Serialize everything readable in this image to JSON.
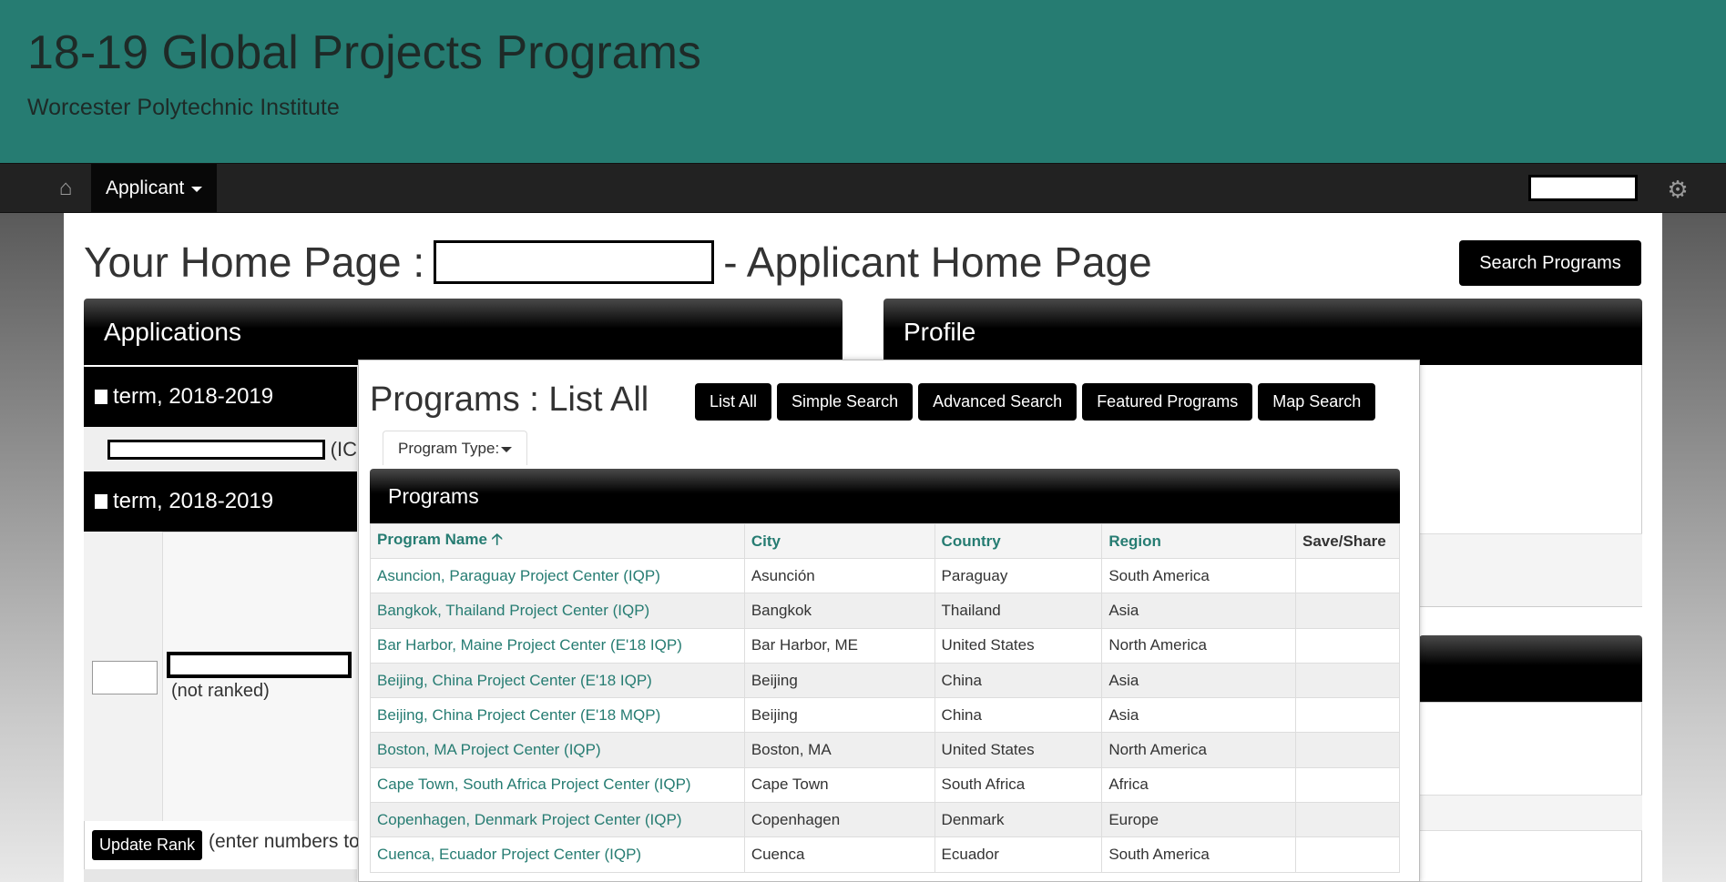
{
  "header": {
    "title": "18-19 Global Projects Programs",
    "subtitle": "Worcester Polytechnic Institute"
  },
  "navbar": {
    "home_icon": "home-icon",
    "applicant_label": "Applicant",
    "settings_icon": "gear-icon"
  },
  "page": {
    "heading_prefix": "Your Home Page :",
    "heading_suffix": "- Applicant Home Page",
    "search_programs_label": "Search Programs"
  },
  "applications": {
    "title": "Applications",
    "terms": [
      {
        "label": "term, 2018-2019"
      },
      {
        "label": "term, 2018-2019"
      }
    ],
    "first_entry_suffix": "(IC",
    "not_ranked": "(not ranked)",
    "update_rank_label": "Update Rank",
    "rank_hint": "(enter numbers to"
  },
  "profile": {
    "title": "Profile"
  },
  "modal": {
    "title": "Programs : List All",
    "buttons": [
      "List All",
      "Simple Search",
      "Advanced Search",
      "Featured Programs",
      "Map Search"
    ],
    "program_type_label": "Program Type:",
    "panel_title": "Programs",
    "columns": [
      "Program Name",
      "City",
      "Country",
      "Region",
      "Save/Share"
    ],
    "sort_indicator": "arrow-up-icon",
    "rows": [
      {
        "name": "Asuncion, Paraguay Project Center (IQP)",
        "city": "Asunción",
        "country": "Paraguay",
        "region": "South America"
      },
      {
        "name": "Bangkok, Thailand Project Center (IQP)",
        "city": "Bangkok",
        "country": "Thailand",
        "region": "Asia"
      },
      {
        "name": "Bar Harbor, Maine Project Center (E'18 IQP)",
        "city": "Bar Harbor, ME",
        "country": "United States",
        "region": "North America"
      },
      {
        "name": "Beijing, China Project Center (E'18 IQP)",
        "city": "Beijing",
        "country": "China",
        "region": "Asia"
      },
      {
        "name": "Beijing, China Project Center (E'18 MQP)",
        "city": "Beijing",
        "country": "China",
        "region": "Asia"
      },
      {
        "name": "Boston, MA Project Center (IQP)",
        "city": "Boston, MA",
        "country": "United States",
        "region": "North America"
      },
      {
        "name": "Cape Town, South Africa Project Center (IQP)",
        "city": "Cape Town",
        "country": "South Africa",
        "region": "Africa"
      },
      {
        "name": "Copenhagen, Denmark Project Center (IQP)",
        "city": "Copenhagen",
        "country": "Denmark",
        "region": "Europe"
      },
      {
        "name": "Cuenca, Ecuador Project Center (IQP)",
        "city": "Cuenca",
        "country": "Ecuador",
        "region": "South America"
      }
    ]
  },
  "colors": {
    "brand": "#267c72",
    "navbar": "#222222",
    "button": "#000000"
  }
}
